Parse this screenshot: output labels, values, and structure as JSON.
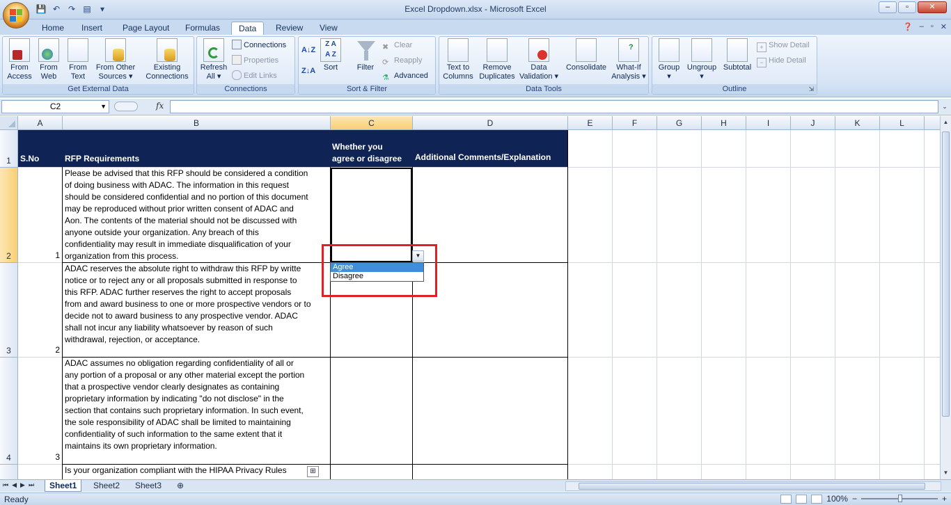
{
  "window": {
    "title": "Excel Dropdown.xlsx - Microsoft Excel",
    "controls": [
      "–",
      "▫",
      "✕"
    ]
  },
  "ribbon_tabs": [
    "Home",
    "Insert",
    "Page Layout",
    "Formulas",
    "Data",
    "Review",
    "View"
  ],
  "active_tab": "Data",
  "ribbon": {
    "get_external_data": {
      "label": "Get External Data",
      "buttons": [
        {
          "line1": "From",
          "line2": "Access"
        },
        {
          "line1": "From",
          "line2": "Web"
        },
        {
          "line1": "From",
          "line2": "Text"
        },
        {
          "line1": "From Other",
          "line2": "Sources ▾"
        },
        {
          "line1": "Existing",
          "line2": "Connections"
        }
      ]
    },
    "connections": {
      "label": "Connections",
      "refresh_line1": "Refresh",
      "refresh_line2": "All ▾",
      "connections": "Connections",
      "properties": "Properties",
      "edit_links": "Edit Links"
    },
    "sort_filter": {
      "label": "Sort & Filter",
      "sort": "Sort",
      "filter": "Filter",
      "clear": "Clear",
      "reapply": "Reapply",
      "advanced": "Advanced"
    },
    "data_tools": {
      "label": "Data Tools",
      "buttons": [
        {
          "line1": "Text to",
          "line2": "Columns"
        },
        {
          "line1": "Remove",
          "line2": "Duplicates"
        },
        {
          "line1": "Data",
          "line2": "Validation ▾"
        },
        {
          "line1": "Consolidate",
          "line2": ""
        },
        {
          "line1": "What-If",
          "line2": "Analysis ▾"
        }
      ]
    },
    "outline": {
      "label": "Outline",
      "group": "Group",
      "ungroup": "Ungroup",
      "subtotal": "Subtotal",
      "show_detail": "Show Detail",
      "hide_detail": "Hide Detail"
    }
  },
  "formula_bar": {
    "name_box": "C2",
    "fx": "fx",
    "formula": ""
  },
  "columns": [
    "A",
    "B",
    "C",
    "D",
    "E",
    "F",
    "G",
    "H",
    "I",
    "J",
    "K",
    "L"
  ],
  "rows": [
    "1",
    "2",
    "3",
    "4"
  ],
  "table": {
    "headers": {
      "a": "S.No",
      "b": "RFP Requirements",
      "c": "Whether you\nagree or disagree",
      "d": "Additional Comments/Explanation"
    },
    "row2": {
      "num": "1",
      "text": "Please be advised that this RFP should be considered a condition\nof doing business with ADAC. The information in this request\nshould be considered confidential and no portion of this document\nmay be reproduced without prior written consent of ADAC and\nAon. The contents of the material should not be discussed with\nanyone outside your organization. Any breach of this\nconfidentiality may result in immediate disqualification of your\norganization from this process."
    },
    "row3": {
      "num": "2",
      "text": "ADAC reserves the absolute right to withdraw this RFP by writte\nnotice or to reject any or all proposals submitted in response to\nthis RFP. ADAC further reserves the right to accept proposals\nfrom and award business to one or more prospective vendors or to\ndecide not to award business to any prospective vendor. ADAC\nshall not incur any liability whatsoever by reason of such\nwithdrawal, rejection, or acceptance."
    },
    "row4": {
      "num": "3",
      "text": "ADAC assumes no obligation regarding confidentiality of all or\nany portion of a proposal or any other material except the portion\nthat a prospective vendor clearly designates as containing\nproprietary information by indicating \"do not disclose\" in the\nsection that contains such proprietary information. In such event,\nthe sole responsibility of ADAC shall be limited to maintaining\nconfidentiality of such information to the same extent that it\nmaintains its own proprietary information."
    },
    "row5_partial": "Is your organization compliant with the HIPAA Privacy Rules"
  },
  "dropdown": {
    "options": [
      "Agree",
      "Disagree"
    ],
    "highlighted": "Agree"
  },
  "sheet_tabs": [
    "Sheet1",
    "Sheet2",
    "Sheet3"
  ],
  "active_sheet": "Sheet1",
  "status": {
    "ready": "Ready",
    "zoom": "100%",
    "minus": "−",
    "plus": "+"
  },
  "colors": {
    "header_fill": "#0f2454",
    "highlight_box": "#e31f26",
    "dropdown_highlight": "#3f8fd8"
  }
}
